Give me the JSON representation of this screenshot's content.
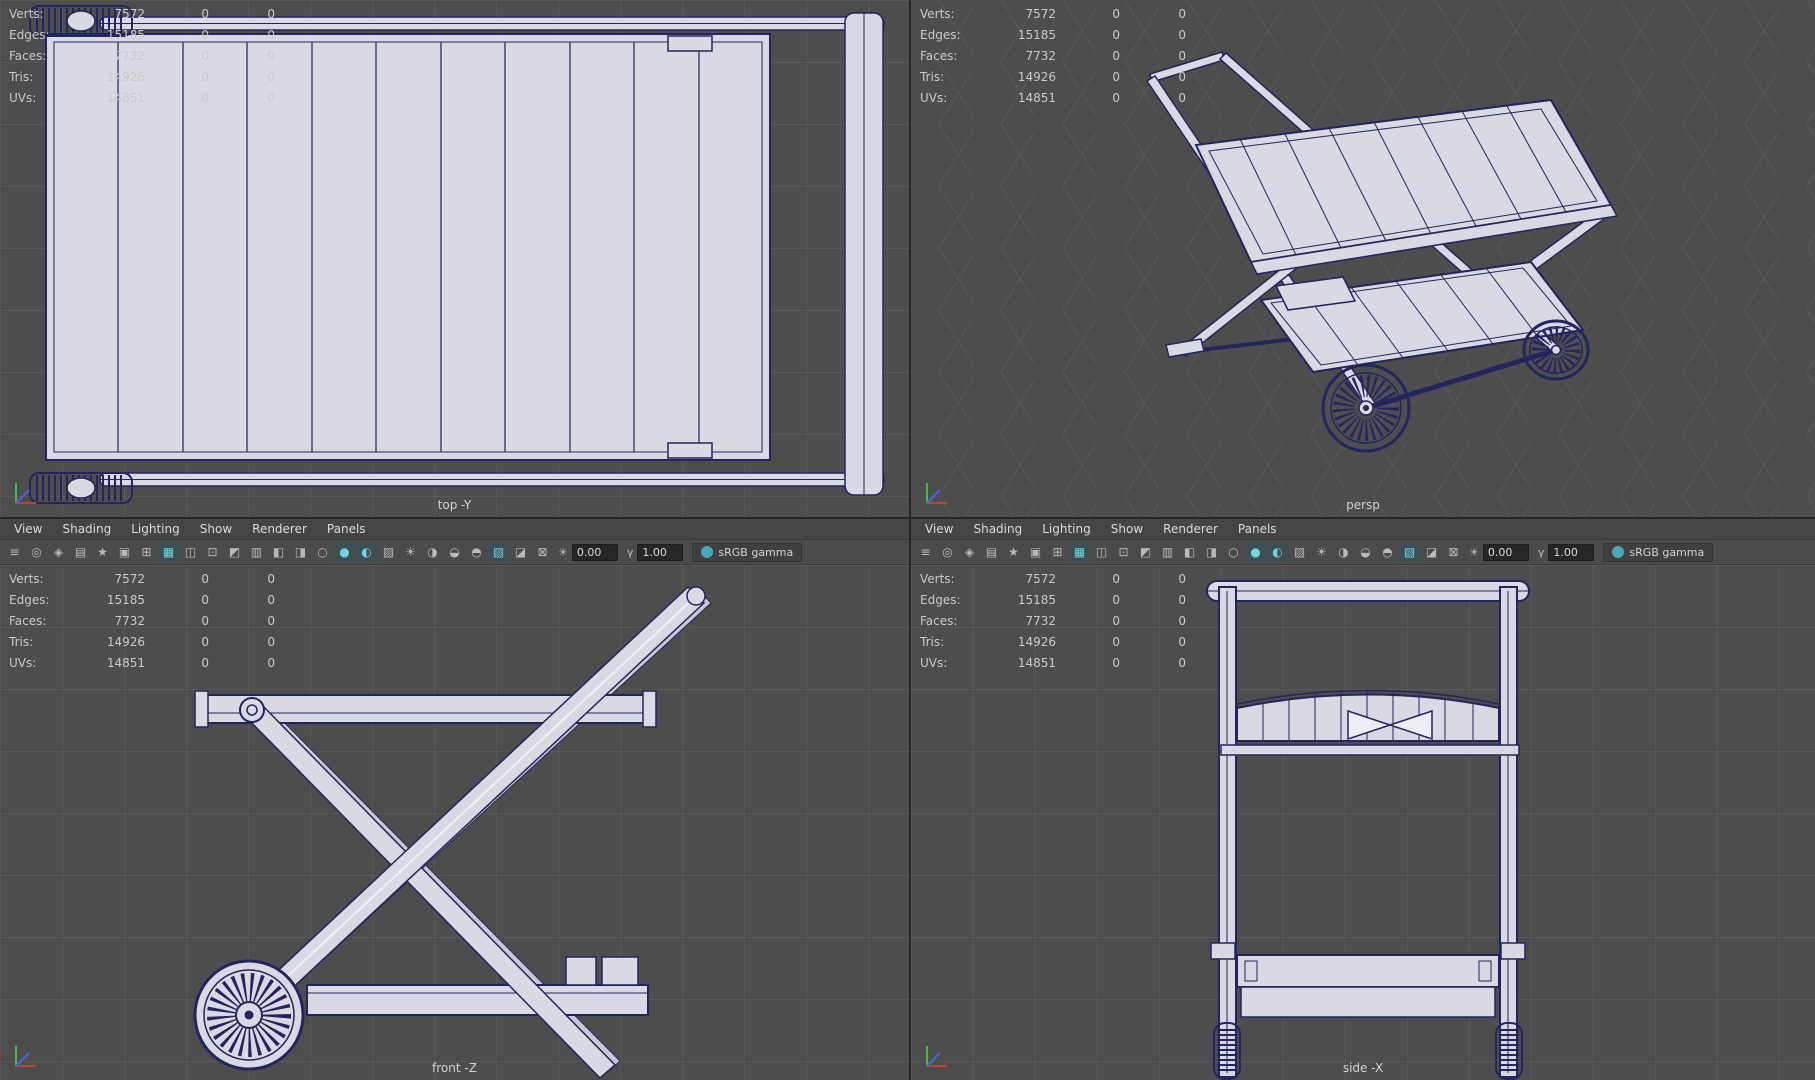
{
  "app": {
    "name": "3D viewport quad layout"
  },
  "colors": {
    "viewport_bg": "#4d4d4d",
    "wireframe": "#23255e",
    "surface": "#d9d9e3",
    "accent_teal": "#49a8b8",
    "hud_text": "#c9c9c9",
    "axis_x": "#cc3b3b",
    "axis_y": "#49b849",
    "axis_z": "#4467dd"
  },
  "hud": {
    "rows": [
      {
        "label": "Verts:",
        "value": "7572",
        "col2": "0",
        "col3": "0"
      },
      {
        "label": "Edges:",
        "value": "15185",
        "col2": "0",
        "col3": "0"
      },
      {
        "label": "Faces:",
        "value": "7732",
        "col2": "0",
        "col3": "0"
      },
      {
        "label": "Tris:",
        "value": "14926",
        "col2": "0",
        "col3": "0"
      },
      {
        "label": "UVs:",
        "value": "14851",
        "col2": "0",
        "col3": "0"
      }
    ]
  },
  "viewports": {
    "top": {
      "label": "top -Y"
    },
    "persp": {
      "label": "persp"
    },
    "front": {
      "label": "front -Z"
    },
    "side": {
      "label": "side -X"
    }
  },
  "menu": {
    "items": [
      {
        "name": "menu-view",
        "label": "View"
      },
      {
        "name": "menu-shading",
        "label": "Shading"
      },
      {
        "name": "menu-lighting",
        "label": "Lighting"
      },
      {
        "name": "menu-show",
        "label": "Show"
      },
      {
        "name": "menu-renderer",
        "label": "Renderer"
      },
      {
        "name": "menu-panels",
        "label": "Panels"
      }
    ]
  },
  "panel_toolbar": {
    "icons": [
      {
        "name": "panel-menu-icon",
        "glyph": "≡",
        "state": "off"
      },
      {
        "name": "select-camera-icon",
        "glyph": "◎",
        "state": "off"
      },
      {
        "name": "lock-camera-icon",
        "glyph": "◈",
        "state": "off"
      },
      {
        "name": "camera-attributes-icon",
        "glyph": "▤",
        "state": "off"
      },
      {
        "name": "bookmarks-icon",
        "glyph": "★",
        "state": "off"
      },
      {
        "name": "image-plane-icon",
        "glyph": "▣",
        "state": "off"
      },
      {
        "name": "two-d-pan-zoom-icon",
        "glyph": "⊞",
        "state": "off"
      },
      {
        "name": "grid-toggle-icon",
        "glyph": "▦",
        "state": "on"
      },
      {
        "name": "film-gate-icon",
        "glyph": "◫",
        "state": "off"
      },
      {
        "name": "resolution-gate-icon",
        "glyph": "⊡",
        "state": "off"
      },
      {
        "name": "gate-mask-icon",
        "glyph": "◩",
        "state": "off"
      },
      {
        "name": "field-chart-icon",
        "glyph": "▥",
        "state": "off"
      },
      {
        "name": "safe-action-icon",
        "glyph": "◧",
        "state": "off"
      },
      {
        "name": "safe-title-icon",
        "glyph": "◨",
        "state": "off"
      },
      {
        "name": "wireframe-mode-icon",
        "glyph": "○",
        "state": "off"
      },
      {
        "name": "smooth-shade-icon",
        "glyph": "●",
        "state": "on"
      },
      {
        "name": "wireframe-on-shaded-icon",
        "glyph": "◐",
        "state": "on"
      },
      {
        "name": "textured-mode-icon",
        "glyph": "▨",
        "state": "off"
      },
      {
        "name": "use-all-lights-icon",
        "glyph": "☀",
        "state": "off"
      },
      {
        "name": "shadows-icon",
        "glyph": "◑",
        "state": "off"
      },
      {
        "name": "screen-space-ao-icon",
        "glyph": "◒",
        "state": "off"
      },
      {
        "name": "motion-blur-icon",
        "glyph": "◓",
        "state": "off"
      },
      {
        "name": "anti-aliasing-icon",
        "glyph": "▧",
        "state": "on"
      },
      {
        "name": "xray-icon",
        "glyph": "◪",
        "state": "off"
      },
      {
        "name": "isolate-select-icon",
        "glyph": "⊠",
        "state": "off"
      }
    ],
    "exposure_icon": "☀",
    "exposure_value": "0.00",
    "gamma_icon": "γ",
    "gamma_value": "1.00",
    "colorspace": {
      "label": "sRGB gamma"
    }
  }
}
